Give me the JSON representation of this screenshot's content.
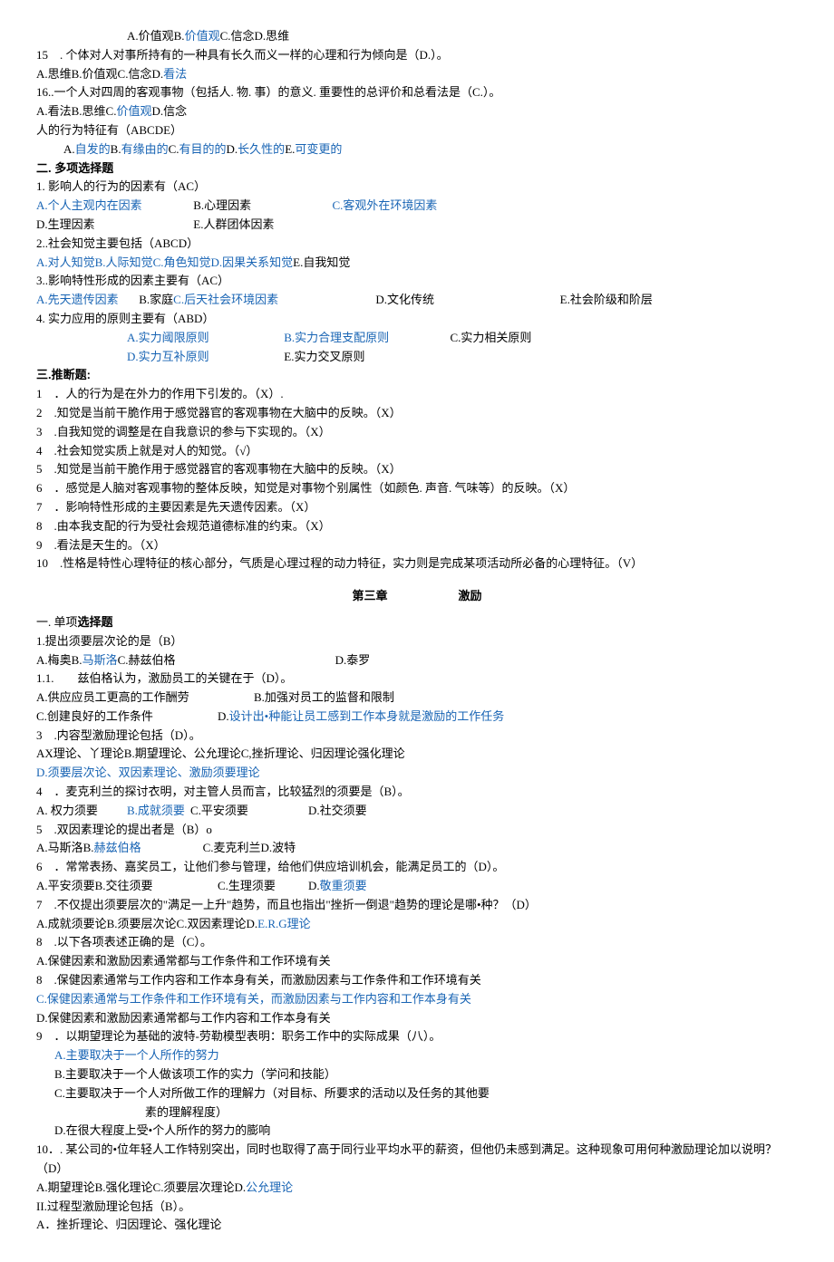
{
  "top": {
    "q14opts": "A.价值观B.",
    "q14opts_link": "价值观",
    "q14opts_tail": "C.信念D.思维",
    "q15": "15　. 个体对人对事所持有的一种具有长久而义一样的心理和行为倾向是（D.）。",
    "q15opts": "A.思维B.价值观C.信念D.",
    "q15opts_link": "看法",
    "q16": "16..一个人对四周的客观事物（包括人. 物. 事）的意义. 重要性的总评价和总看法是（C.）。",
    "q16opts": "A.看法B.思维C.",
    "q16opts_link": "价值观",
    "q16opts_tail": "D.信念",
    "b1": "人的行为特征有（ABCDE）",
    "b1a": "A.",
    "b1a_l": "自发的",
    "b1b": "B.",
    "b1b_l": "有缘由的",
    "b1c": "C.",
    "b1c_l": "有目的的",
    "b1d": "D.",
    "b1d_l": "长久性的",
    "b1e": "E.",
    "b1e_l": "可变更的"
  },
  "sec2title": "二. 多项选择题",
  "mc": {
    "q1": "1. 影响人的行为的因素有（AC）",
    "q1a_l": "A.个人主观内在因素",
    "q1b": "B.心理因素",
    "q1c_l": "C.客观外在环境因素",
    "q1d": "D.生理因素",
    "q1e": "E.人群团体因素",
    "q2": "2..社会知觉主要包括（ABCD）",
    "q2a_l": "A.对人知觉",
    "q2b_l": "B.人际知觉",
    "q2c_l": "C.角色知觉",
    "q2d_l": "D.因果关系知觉",
    "q2e": "E.自我知觉",
    "q3": "3..影响特性形成的因素主要有（AC）",
    "q3a_l": "A.先天遗传因素",
    "q3b": "B.家庭",
    "q3c_l": "C.后天社会环境因素",
    "q3d": "D.文化传统",
    "q3e": "E.社会阶级和阶层",
    "q4": "4. 实力应用的原则主要有（ABD）",
    "q4a_l": "A.实力阈限原则",
    "q4b_l": "B.实力合理支配原则",
    "q4c": "C.实力相关原则",
    "q4d_l": "D.实力互补原则",
    "q4e": "E.实力交叉原则"
  },
  "sec3title": "三.推断题:",
  "tf": {
    "q1": "1　．人的行为是在外力的作用下引发的。（X）.",
    "q2": "2　.知觉是当前干脆作用于感觉器官的客观事物在大脑中的反映。（X）",
    "q3": "3　.自我知觉的调整是在自我意识的参与下实现的。（X）",
    "q4": "4　.社会知觉实质上就是对人的知觉。（√）",
    "q5": "5　.知觉是当前干脆作用于感觉器官的客观事物在大脑中的反映。（X）",
    "q6": "6　．感觉是人脑对客观事物的整体反映，知觉是对事物个别属性（如颜色. 声音. 气味等）的反映。（X）",
    "q7": "7　．影响特性形成的主要因素是先天遗传因素。（X）",
    "q8": "8　.由本我支配的行为受社会规范道德标准的约束。（X）",
    "q9": "9　.看法是天生的。（X）",
    "q10": "10　.性格是特性心理特征的核心部分，气质是心理过程的动力特征，实力则是完成某项活动所必备的心理特征。（V）"
  },
  "chapter": "第三章　　　　　　激励",
  "sec1btitle": "一. 单项选择题",
  "sc": {
    "q1": "1.提出须要层次论的是（B）",
    "q1opts_a": "A.梅奥B.",
    "q1opts_b_l": "马斯洛",
    "q1opts_c": "C.赫兹伯格",
    "q1opts_d": "D.泰罗",
    "q1_1": "1.1.　　兹伯格认为，激励员工的关键在于（D）。",
    "q1_1a": "A.供应应员工更高的工作酬劳",
    "q1_1b": "B.加强对员工的监督和限制",
    "q1_1c": "C.创建良好的工作条件",
    "q1_1d": "D.",
    "q1_1d_l": "设计出•种能让员工感到工作本身就是激励的工作任务",
    "q3": "3　.内容型激励理论包括（D）。",
    "q3a": "AX理论、丫理论B.期望理论、公允理论C,挫折理论、归因理论强化理论",
    "q3d_l": "D.须要层次论、双因素理论、激励须要理论",
    "q4": "4　．麦克利兰的探讨衣明，对主管人员而言，比较猛烈的须要是（B）。",
    "q4a": "A. 权力须要",
    "q4b_l": "B.成就须要",
    "q4c": "C.平安须要",
    "q4d": "D.社交须要",
    "q5": "5　.双因素理论的提出者是（B）o",
    "q5a": "A.马斯洛B.",
    "q5b_l": "赫兹伯格",
    "q5c": "C.麦克利兰D.波特",
    "q6": "6　．常常表扬、嘉奖员工，让他们参与管理，给他们供应培训机会，能满足员工的（D）。",
    "q6a": "A.平安须要B.交往须要",
    "q6c": "C.生理须要",
    "q6d": "D.",
    "q6d_l": "敬重须要",
    "q7": "7　.不仅提出须要层次的\"满足一上升\"趋势，而且也指出\"挫折一倒退\"趋势的理论是哪•种？（D）",
    "q7a": "A.成就须要论B.须要层次论C.双因素理论D.",
    "q7d_l": "E.R.G理论",
    "q8": "8　.以下各项表述正确的是（C）。",
    "q8a": "A.保健因素和激励因素通常都与工作条件和工作环境有关",
    "q8b": "8　.保健因素通常与工作内容和工作本身有关，而激励因素与工作条件和工作环境有关",
    "q8c_l": "C.保健因素通常与工作条件和工作环境有关，而激励因素与工作内容和工作本身有关",
    "q8d": "D.保健因素和激励因素通常都与工作内容和工作本身有关",
    "q9": "9　．以期望理论为基础的波特-劳勒模型表明：职务工作中的实际成果（八）。",
    "q9a_l": "A.主要取决于一个人所作的努力",
    "q9b": "B.主要取决于一个人做该项工作的实力（学问和技能）",
    "q9c": "C.主要取决于一个人对所做工作的理解力（对目标、所要求的活动以及任务的其他要",
    "q9c2": "素的理解程度）",
    "q9d": "D.在很大程度上受•个人所作的努力的膨响",
    "q10": "10．. 某公司的•位年轻人工作特别突出，同时也取得了高于同行业平均水平的薪资，但他仍未感到满足。这种现象可用何种激励理论加以说明？（D）",
    "q10a": "A.期望理论B.强化理论C.须要层次理论D.",
    "q10d_l": "公允理论",
    "q11": "II.过程型激励理论包括（B）。",
    "q11a": "A．挫折理论、归因理论、强化理论"
  }
}
